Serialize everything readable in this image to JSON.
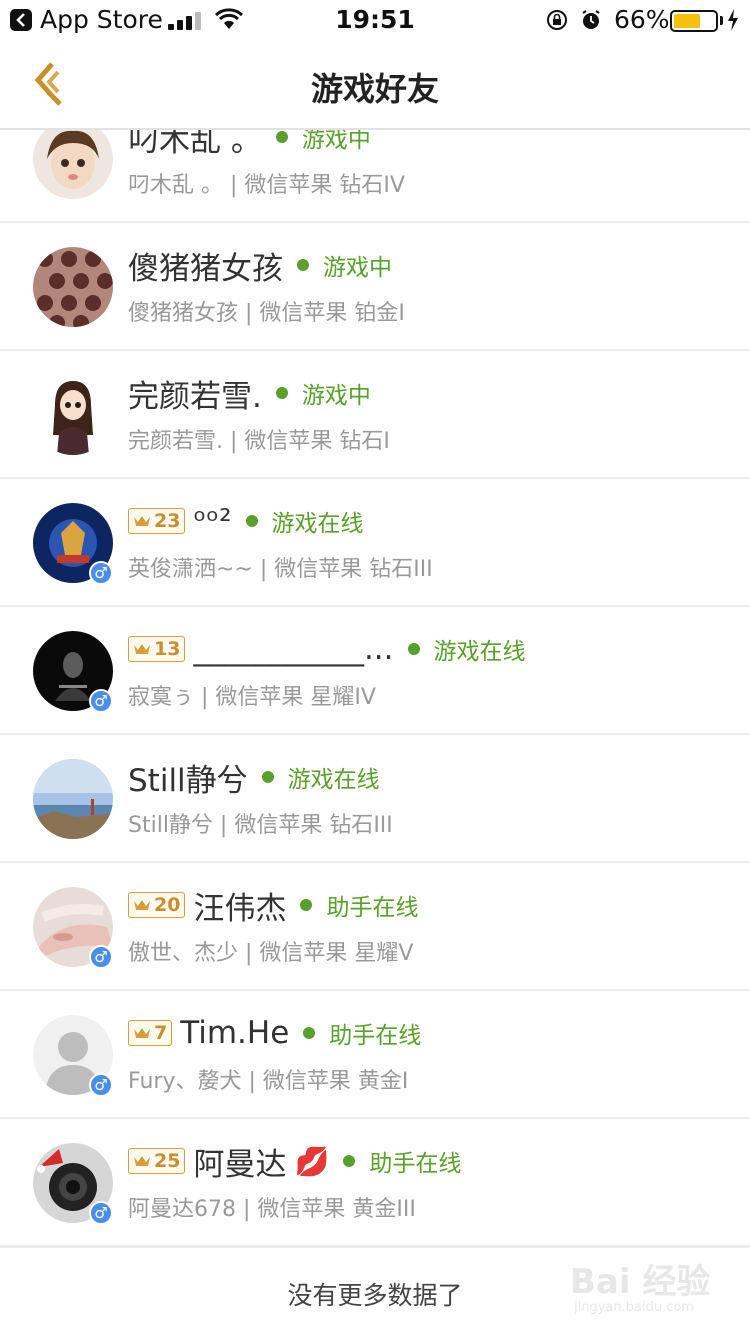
{
  "status_bar": {
    "back_app": "App Store",
    "time": "19:51",
    "battery": "66%",
    "battery_level": 0.66
  },
  "nav": {
    "title": "游戏好友"
  },
  "friends": [
    {
      "name": "叼木乱 。",
      "status": "游戏中",
      "detail": "叼木乱 。 | 微信苹果 钻石IV",
      "level": "",
      "male": false
    },
    {
      "name": "傻猪猪女孩",
      "status": "游戏中",
      "detail": "傻猪猪女孩 | 微信苹果 铂金I",
      "level": "",
      "male": false
    },
    {
      "name": "完颜若雪.",
      "status": "游戏中",
      "detail": "完颜若雪. | 微信苹果 钻石I",
      "level": "",
      "male": false
    },
    {
      "name": "ᵒᵒ²",
      "status": "游戏在线",
      "detail": "英俊潇洒~~ | 微信苹果 钻石III",
      "level": "23",
      "male": true
    },
    {
      "name": "___________...",
      "status": "游戏在线",
      "detail": "寂寞ぅ | 微信苹果 星耀IV",
      "level": "13",
      "male": true
    },
    {
      "name": "Still静兮",
      "status": "游戏在线",
      "detail": "Still静兮 | 微信苹果 钻石III",
      "level": "",
      "male": false
    },
    {
      "name": "汪伟杰",
      "status": "助手在线",
      "detail": "傲世、杰少 | 微信苹果 星耀V",
      "level": "20",
      "male": true
    },
    {
      "name": "Tim.He",
      "status": "助手在线",
      "detail": "Fury、嫠犬 | 微信苹果 黄金I",
      "level": "7",
      "male": true
    },
    {
      "name": "阿曼达",
      "status": "助手在线",
      "detail": "阿曼达678 | 微信苹果 黄金III",
      "level": "25",
      "male": true,
      "emoji": "💋"
    }
  ],
  "gender_symbol": "♂",
  "footer": {
    "text": "没有更多数据了"
  },
  "watermark": {
    "text": "Bai 经验",
    "sub": "jingyan.baidu.com"
  },
  "colors": {
    "online_green": "#5aa02c",
    "crown_gold": "#d4a03c",
    "male_blue": "#4a8ee8",
    "back_arrow": "#c8902c"
  }
}
